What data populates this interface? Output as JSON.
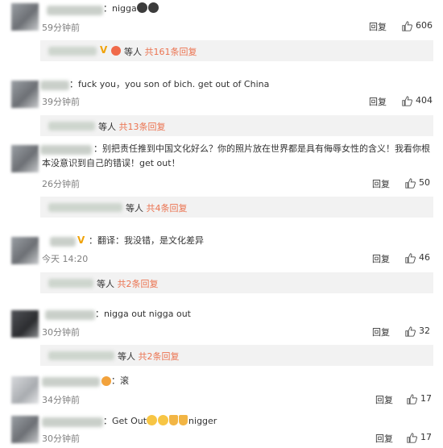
{
  "comments": [
    {
      "text": "：nigga",
      "emoji_count": 2,
      "time": "59分钟前",
      "reply_label": "回复",
      "likes": "606",
      "thread": {
        "suffix": "等人",
        "link": "共161条回复"
      }
    },
    {
      "text": "：fuck you，you son of bich. get out of China",
      "time": "39分钟前",
      "reply_label": "回复",
      "likes": "404",
      "thread": {
        "suffix": "等人",
        "link": "共13条回复"
      }
    },
    {
      "text": "：别把责任推到中国文化好么？你的照片放在世界都是具有侮辱女性的含义！我看你根本没意识到自己的错误！get out！",
      "time": "26分钟前",
      "reply_label": "回复",
      "likes": "50",
      "thread": {
        "suffix": "等人",
        "link": "共4条回复"
      }
    },
    {
      "text": "：翻译：我没错，是文化差异",
      "time": "今天 14:20",
      "reply_label": "回复",
      "likes": "46",
      "thread": {
        "suffix": "等人",
        "link": "共2条回复"
      }
    },
    {
      "text": "：nigga out nigga out",
      "time": "30分钟前",
      "reply_label": "回复",
      "likes": "32",
      "thread": {
        "suffix": "等人",
        "link": "共2条回复"
      }
    },
    {
      "text": "：滚",
      "time": "34分钟前",
      "reply_label": "回复",
      "likes": "17"
    },
    {
      "text_before": "：Get Out",
      "text_after": "nigger",
      "time": "30分钟前",
      "reply_label": "回复",
      "likes": "17"
    }
  ],
  "colors": {
    "link": "#eb7350",
    "muted": "#808080",
    "reply_bg": "#f2f2f2"
  },
  "icons": {
    "like": "thumbs-up-icon"
  }
}
